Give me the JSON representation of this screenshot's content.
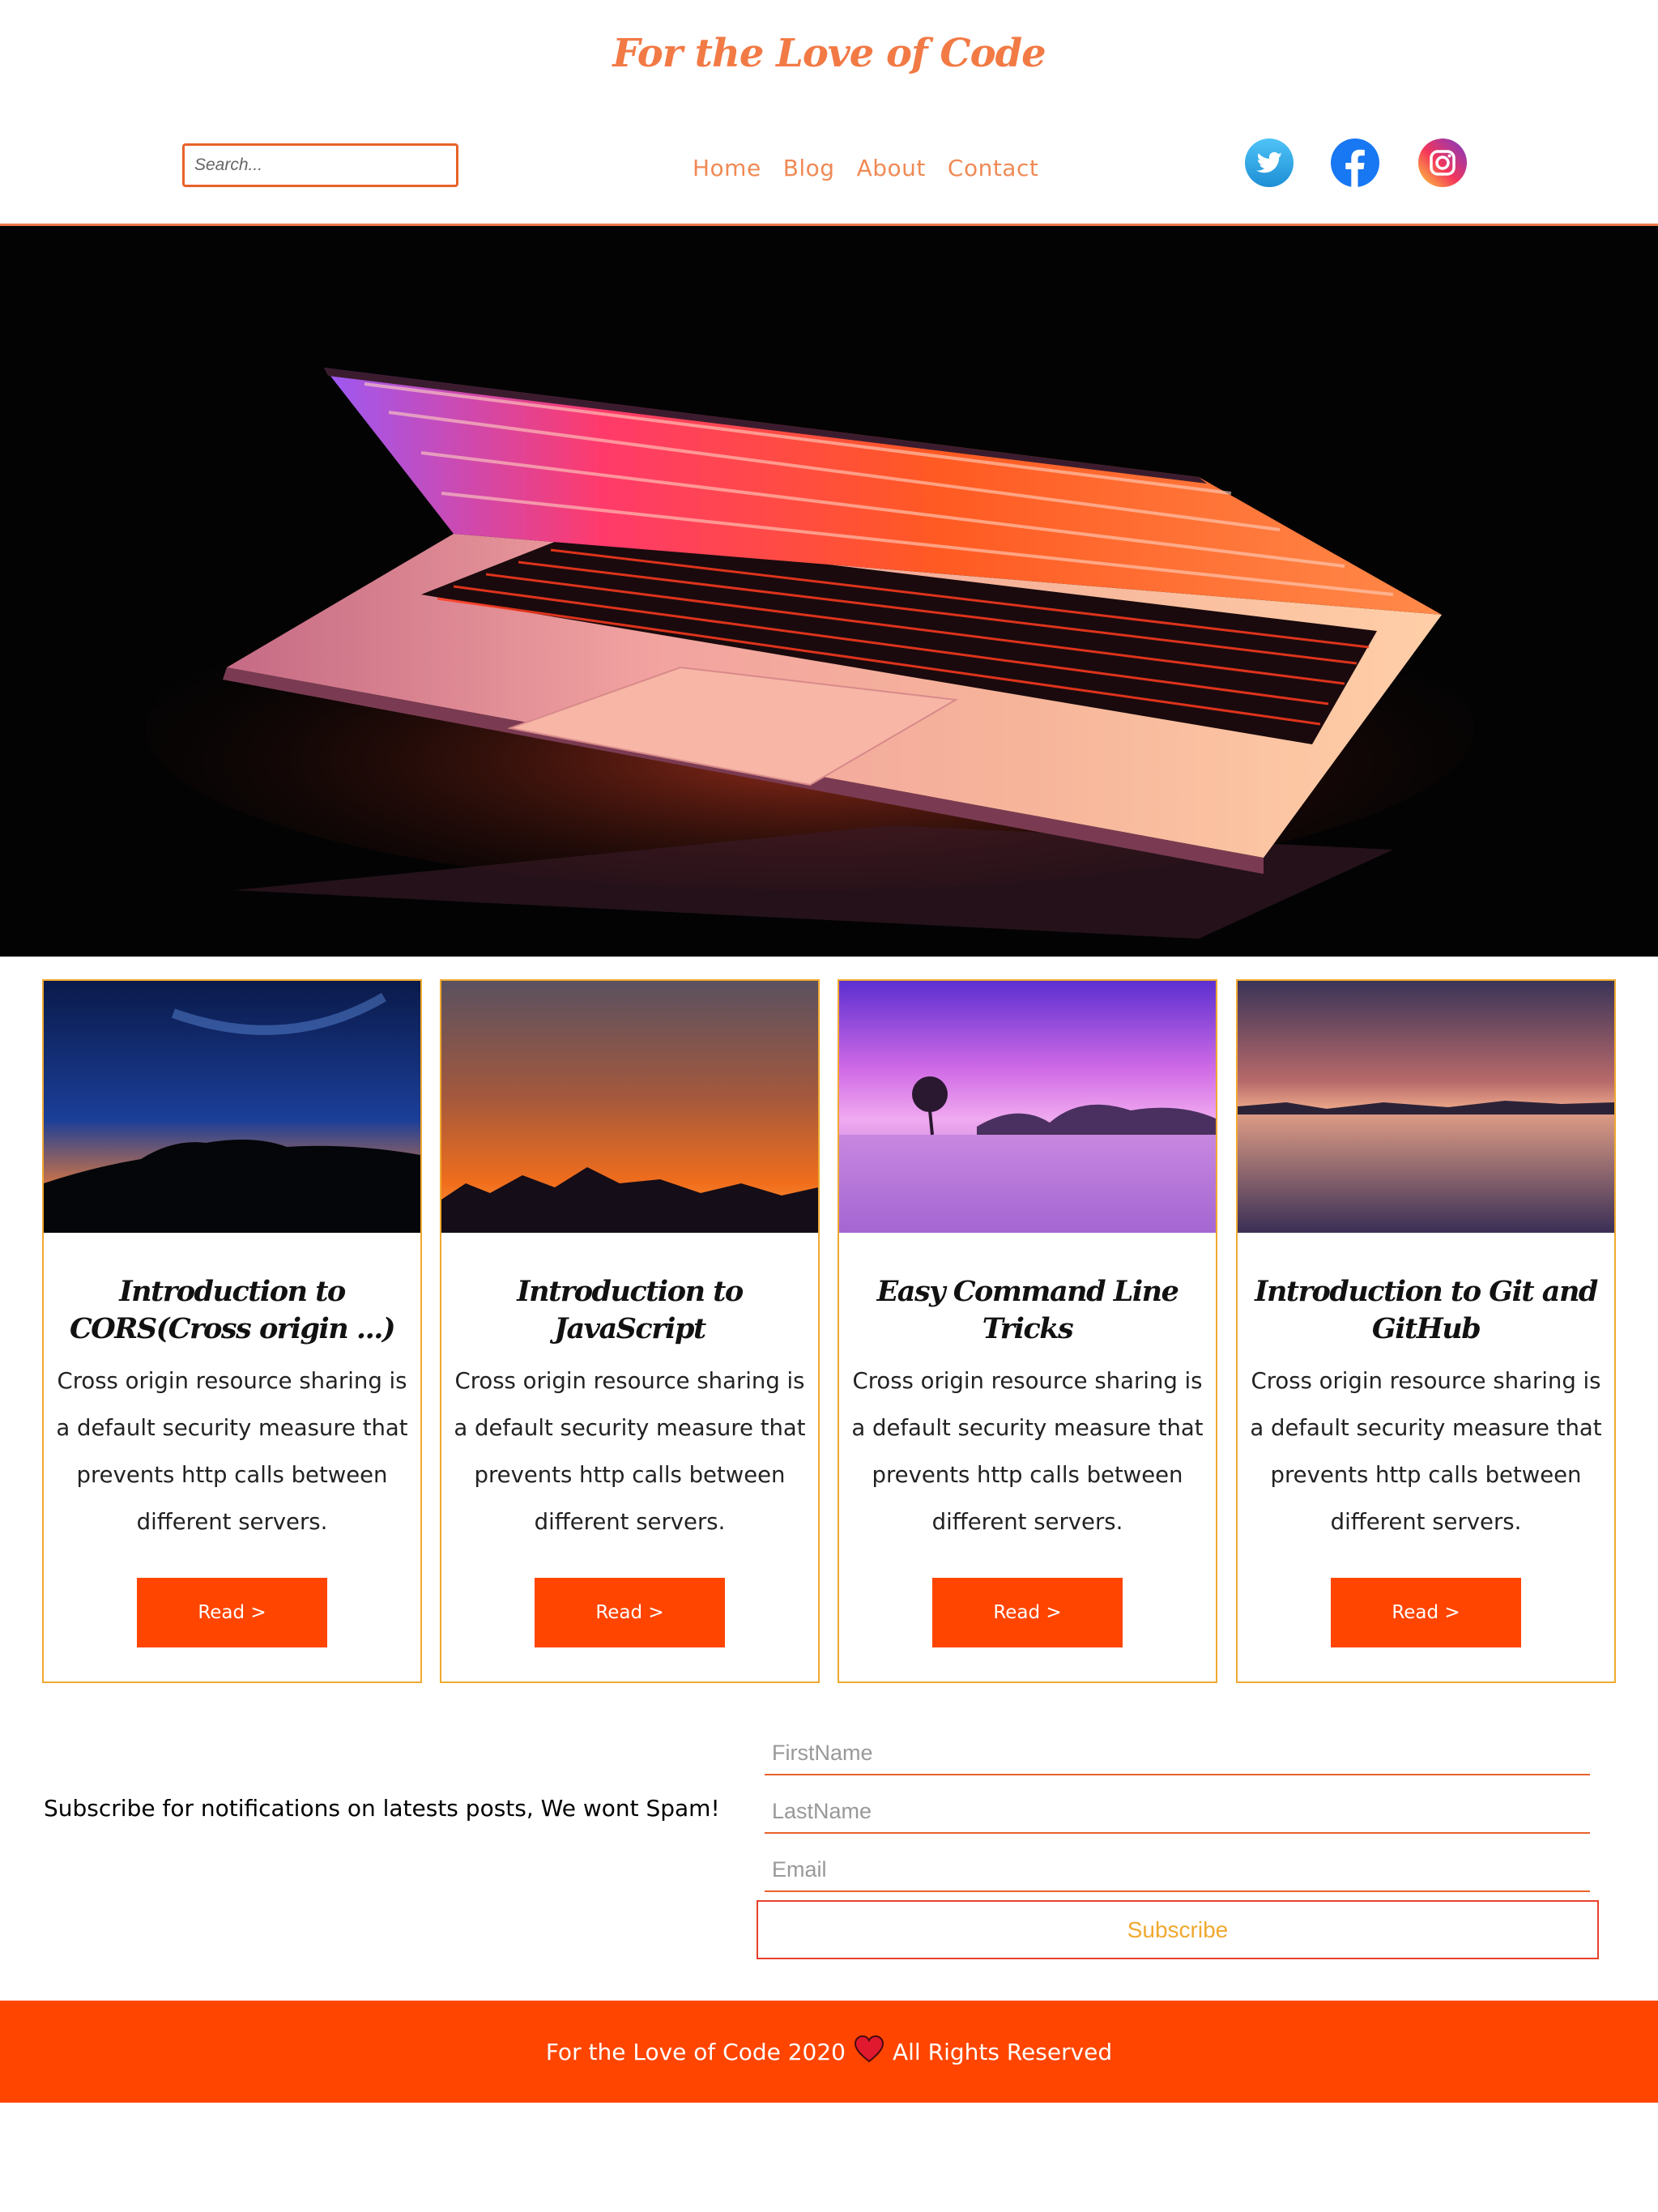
{
  "site": {
    "title": "For the Love of Code"
  },
  "search": {
    "placeholder": "Search..."
  },
  "nav": {
    "items": [
      "Home",
      "Blog",
      "About",
      "Contact"
    ]
  },
  "social": {
    "icons": [
      "twitter-icon",
      "facebook-icon",
      "instagram-icon"
    ]
  },
  "colors": {
    "accent": "#ff4500",
    "title": "#f27a45",
    "nav": "#f08a55",
    "card_border": "#f0a930"
  },
  "posts": [
    {
      "title": "Introduction to CORS(Cross origin ...)",
      "excerpt": "Cross origin resource sharing is a default security measure that prevents http calls between different servers.",
      "button": "Read >"
    },
    {
      "title": "Introduction to JavaScript",
      "excerpt": "Cross origin resource sharing is a default security measure that prevents http calls between different servers.",
      "button": "Read >"
    },
    {
      "title": "Easy Command Line Tricks",
      "excerpt": "Cross origin resource sharing is a default security measure that prevents http calls between different servers.",
      "button": "Read >"
    },
    {
      "title": "Introduction to Git and GitHub",
      "excerpt": "Cross origin resource sharing is a default security measure that prevents http calls between different servers.",
      "button": "Read >"
    }
  ],
  "subscribe": {
    "text": "Subscribe for notifications on latests posts, We wont Spam!",
    "firstname_placeholder": "FirstName",
    "lastname_placeholder": "LastName",
    "email_placeholder": "Email",
    "button": "Subscribe"
  },
  "footer": {
    "left": "For the Love of Code 2020",
    "right": "All Rights Reserved"
  }
}
